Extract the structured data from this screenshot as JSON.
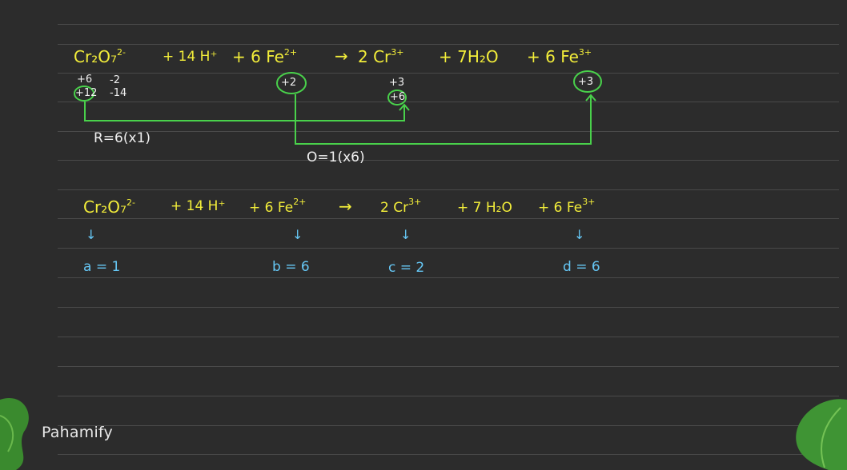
{
  "equation1": {
    "dichromate_base": "Cr₂O₇",
    "dichromate_charge": "2-",
    "h_term": "+ 14 H⁺",
    "fe2_term": "+ 6 Fe",
    "fe2_charge": "2+",
    "arrow": "→",
    "cr3_term": "2 Cr",
    "cr3_charge": "3+",
    "water_term": "+ 7H₂O",
    "fe3_term": "+ 6 Fe",
    "fe3_charge": "3+"
  },
  "oxidation_states": {
    "cr_state": "+6",
    "o_state": "-2",
    "cr_total": "+12",
    "o_total": "-14",
    "fe2_state": "+2",
    "cr3_state": "+3",
    "cr3_total": "+6",
    "fe3_state": "+3"
  },
  "changes": {
    "reduction": "R=6(x1)",
    "oxidation": "O=1(x6)"
  },
  "equation2": {
    "dichromate_base": "Cr₂O₇",
    "dichromate_charge": "2-",
    "h_term": "+ 14 H⁺",
    "fe2_term": "+ 6 Fe",
    "fe2_charge": "2+",
    "arrow": "→",
    "cr3_term": "2 Cr",
    "cr3_charge": "3+",
    "water_term": "+ 7 H₂O",
    "fe3_term": "+ 6 Fe",
    "fe3_charge": "3+"
  },
  "coefficients": {
    "arrow_symbol": "↓",
    "a": "a = 1",
    "b": "b = 6",
    "c": "c = 2",
    "d": "d = 6"
  },
  "branding": {
    "logo_text": "Pahamify"
  },
  "colors": {
    "board": "#2c2c2c",
    "rule": "#4a4a4a",
    "yellow_ink": "#f3ee3a",
    "white_ink": "#f0f0f0",
    "blue_ink": "#66c7f5",
    "green_ink": "#49d14b",
    "leaf": "#3a8a2e"
  }
}
